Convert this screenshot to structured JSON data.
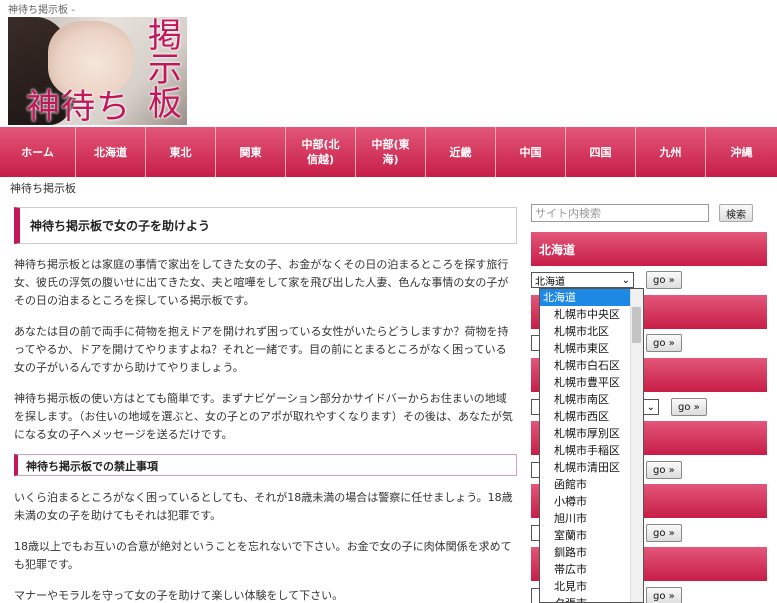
{
  "site": {
    "subtitle": "神待ち掲示板 -"
  },
  "logo": {
    "text_left": "神待ち",
    "text_right": "掲示板"
  },
  "nav": [
    {
      "label": "ホーム"
    },
    {
      "label": "北海道"
    },
    {
      "label": "東北"
    },
    {
      "label": "関東"
    },
    {
      "label": "中部(北信越)"
    },
    {
      "label": "中部(東海)"
    },
    {
      "label": "近畿"
    },
    {
      "label": "中国"
    },
    {
      "label": "四国"
    },
    {
      "label": "九州"
    },
    {
      "label": "沖縄"
    }
  ],
  "breadcrumb": "神待ち掲示板",
  "main": {
    "heading": "神待ち掲示板で女の子を助けよう",
    "p1": "神待ち掲示板とは家庭の事情で家出をしてきた女の子、お金がなくその日の泊まるところを探す旅行女、彼氏の浮気の腹いせに出てきた女、夫と喧嘩をして家を飛び出した人妻、色んな事情の女の子がその日の泊まるところを探している掲示板です。",
    "p2": "あなたは目の前で両手に荷物を抱えドアを開けれず困っている女性がいたらどうしますか？荷物を持ってやるか、ドアを開けてやりますよね？それと一緒です。目の前にとまるところがなく困っている女の子がいるんですから助けてやりましょう。",
    "p3": "神待ち掲示板の使い方はとても簡単です。まずナビゲーション部分かサイドバーからお住まいの地域を探します。（お住いの地域を選ぶと、女の子とのアポが取れやすくなります）その後は、あなたが気になる女の子へメッセージを送るだけです。",
    "heading2": "神待ち掲示板での禁止事項",
    "p4": "いくら泊まるところがなく困っているとしても、それが18歳未満の場合は警察に任せましょう。18歳未満の女の子を助けてもそれは犯罪です。",
    "p5": "18歳以上でもお互いの合意が絶対ということを忘れないで下さい。お金で女の子に肉体関係を求めても犯罪です。",
    "p6": "マナーやモラルを守って女の子を助けて楽しい体験をして下さい。"
  },
  "sidebar": {
    "search_placeholder": "サイト内検索",
    "search_button": "検索",
    "widget_title": "北海道",
    "select_value": "北海道",
    "go_label": "go »"
  },
  "dropdown_options": [
    "北海道",
    "札幌市中央区",
    "札幌市北区",
    "札幌市東区",
    "札幌市白石区",
    "札幌市豊平区",
    "札幌市南区",
    "札幌市西区",
    "札幌市厚別区",
    "札幌市手稲区",
    "札幌市清田区",
    "函館市",
    "小樽市",
    "旭川市",
    "室蘭市",
    "釧路市",
    "帯広市",
    "北見市",
    "夕張市"
  ]
}
